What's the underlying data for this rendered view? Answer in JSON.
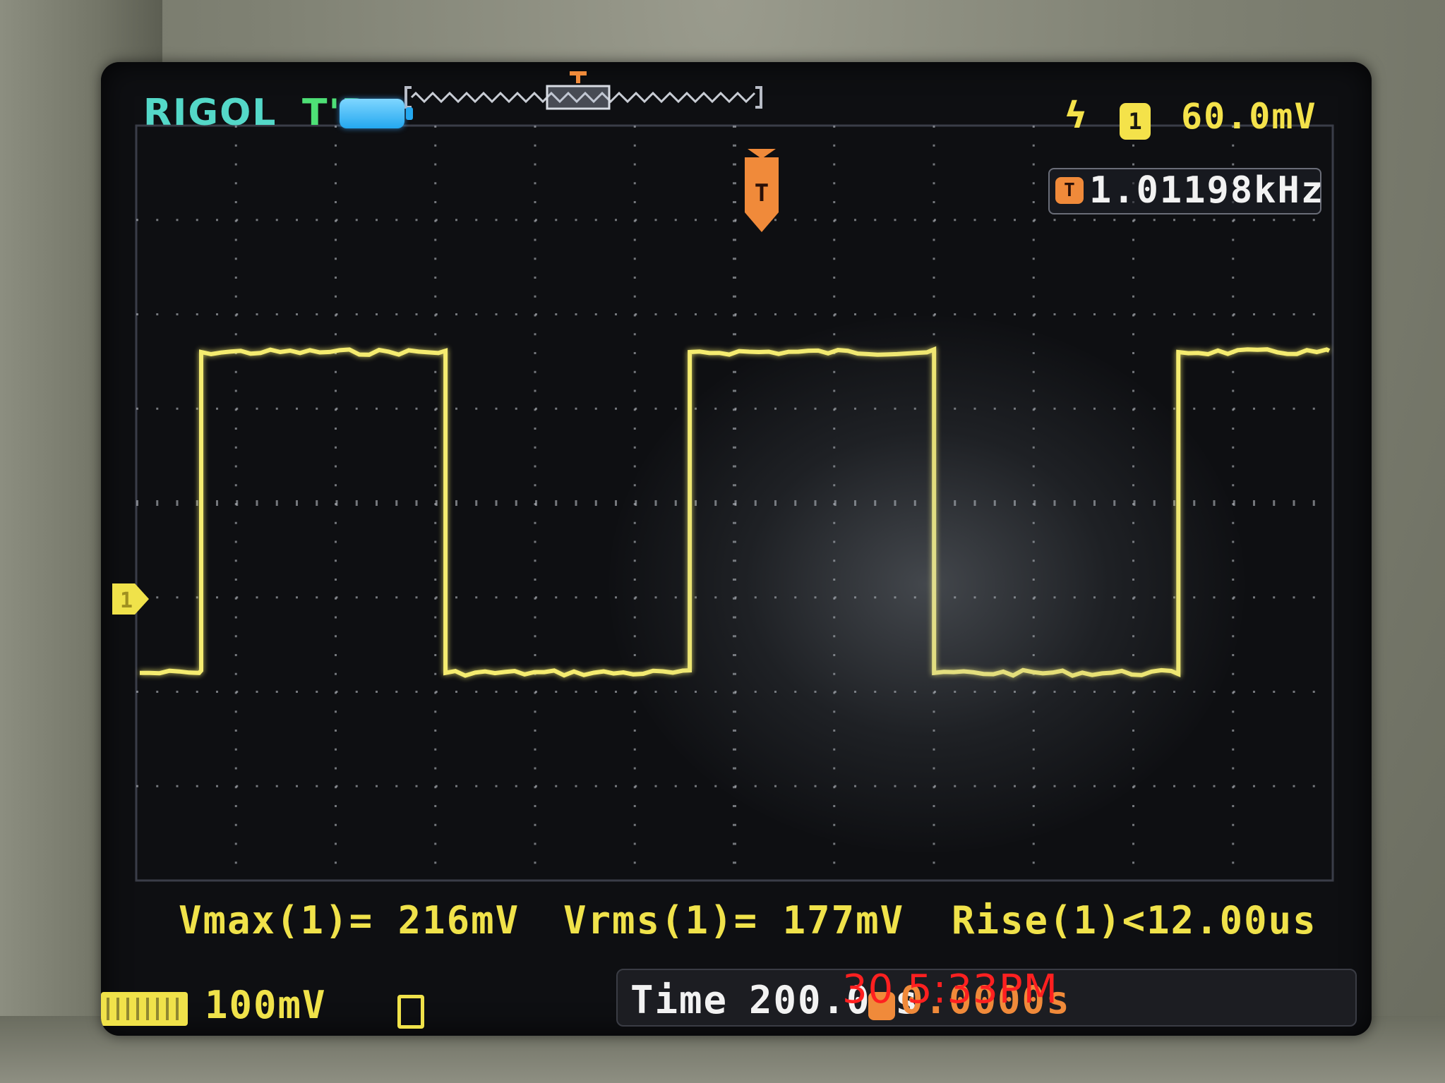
{
  "header": {
    "brand": "RIGOL",
    "run_status": "T'D",
    "trigger_level": "60.0mV",
    "trigger_source_icon": "1",
    "trigger_edge_icon": "rising-edge-icon"
  },
  "frequency_counter": {
    "icon": "T",
    "value": "1.01198kHz"
  },
  "measurements": {
    "vmax": "Vmax(1)= 216mV",
    "vrms": "Vrms(1)= 177mV",
    "rise": "Rise(1)<12.00us"
  },
  "status_bar": {
    "ch1_scale": "100mV",
    "time_label": "Time",
    "time_value": "200.0us",
    "trigger_offset": "0.0000s",
    "photo_timestamp": "30 5:33PM"
  },
  "markers": {
    "channel": "1",
    "trigger": "T"
  },
  "colors": {
    "brand": "#54d8c8",
    "run_status": "#4ee076",
    "channel1": "#f0e24a",
    "trigger": "#f08a3a",
    "grid": "#c8ccd4",
    "timestamp": "#ff2020"
  },
  "waveform": {
    "type": "square",
    "period_divisions": 4.9,
    "high_level": 1.6,
    "low_level": -1.8
  }
}
